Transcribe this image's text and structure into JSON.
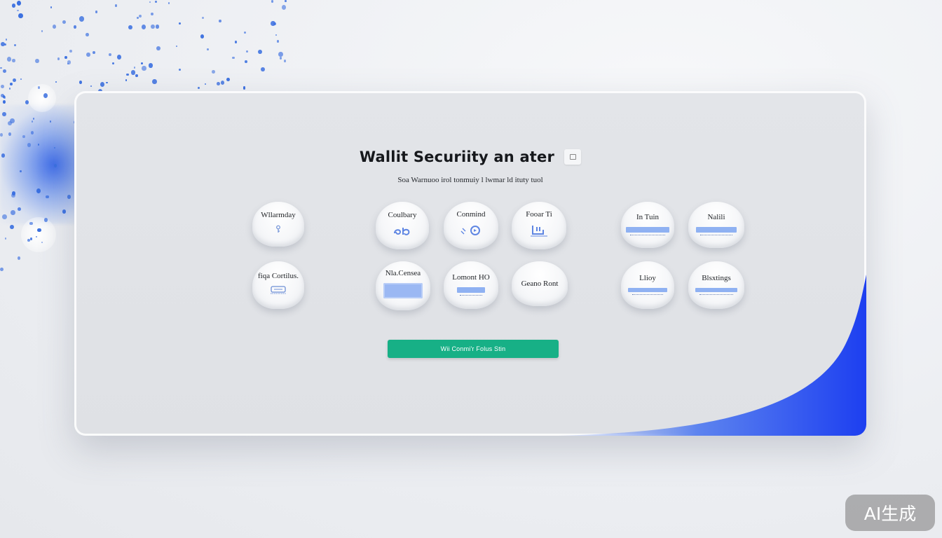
{
  "panel": {
    "title": "Wallit Securiity an ater",
    "subtitle": "Soa  Warnuoo irol  tonmuiy  l  lwmar ld ituty  tuol"
  },
  "options_left": [
    {
      "label": "Wllarmday",
      "icon": "key-icon"
    },
    {
      "label": "fiqa Cortilus.",
      "icon": "card-icon"
    }
  ],
  "options_center": [
    {
      "label": "Coulbary",
      "icon": "link-icon"
    },
    {
      "label": "Conmind",
      "icon": "refresh-icon"
    },
    {
      "label": "Fooar Ti",
      "icon": "plug-icon"
    },
    {
      "label": "Nla.Censea",
      "icon": "document-icon"
    },
    {
      "label": "Lomont HO",
      "icon": "list-icon"
    },
    {
      "label": "Geano Ront",
      "icon": ""
    }
  ],
  "options_right": [
    {
      "label": "In  Tuin",
      "icon": "toggle-bar-icon"
    },
    {
      "label": "Nalili",
      "icon": "toggle-bar-icon"
    },
    {
      "label": "Llioy",
      "icon": "toggle-bar-icon"
    },
    {
      "label": "Blsxtings",
      "icon": "toggle-bar-icon"
    }
  ],
  "continue_button": {
    "label": "Wii Conmi'r Folus Stin"
  },
  "badge": {
    "label": "AI生成"
  },
  "colors": {
    "accent_green": "#17b086",
    "accent_blue": "#2a4ff0",
    "panel_bg": "#e1e3e7"
  }
}
